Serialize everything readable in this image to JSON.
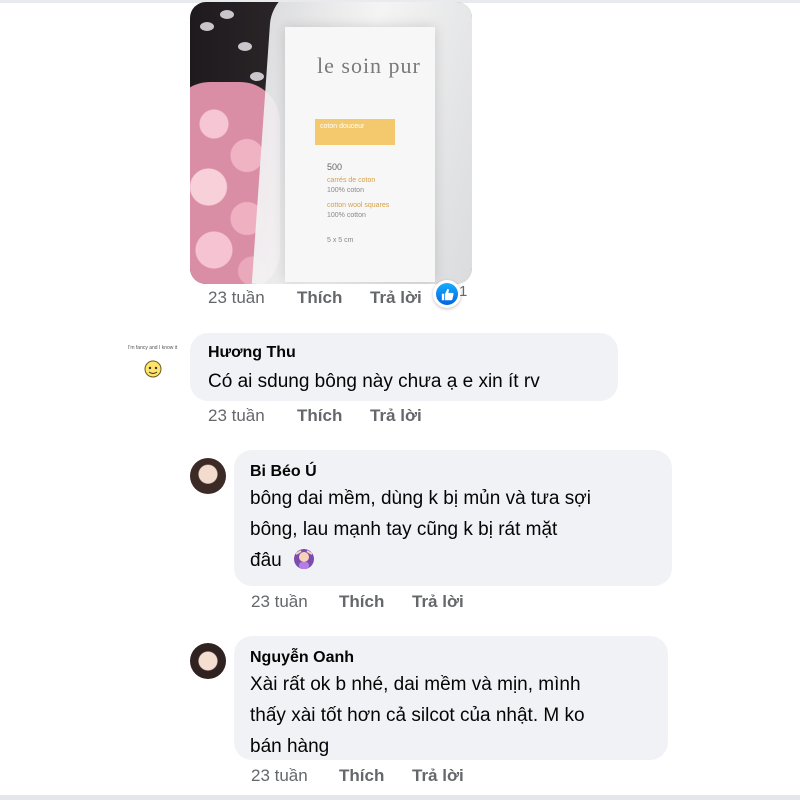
{
  "post_photo": {
    "brand_text": "le soin pur",
    "band_text": "coton douceur",
    "count_text": "500",
    "line1": "carrés de coton",
    "line2": "100% coton",
    "line3": "cotton wool squares",
    "line4": "100% cotton",
    "size_text": "5 x 5 cm"
  },
  "photo_meta": {
    "time": "23 tuần",
    "like_label": "Thích",
    "reply_label": "Trả lời",
    "reaction_count": "1"
  },
  "comments": [
    {
      "author": "Hương Thu",
      "avatar_caption": "I'm fancy and I know it",
      "text": "Có ai sdung bông này chưa ạ e xin ít rv",
      "time": "23 tuần",
      "like_label": "Thích",
      "reply_label": "Trả lời"
    },
    {
      "author": "Bi Béo Ú",
      "text_lines": [
        "bông dai mềm, dùng k bị mủn và tưa sợi",
        "bông, lau mạnh tay cũng k bị rát mặt",
        "đâu"
      ],
      "time": "23 tuần",
      "like_label": "Thích",
      "reply_label": "Trả lời"
    },
    {
      "author": "Nguyễn Oanh",
      "text_lines": [
        "Xài rất ok b nhé, dai mềm và mịn, mình",
        "thấy xài tốt hơn cả silcot của nhật. M ko",
        "bán hàng"
      ],
      "time": "23 tuần",
      "like_label": "Thích",
      "reply_label": "Trả lời"
    }
  ],
  "colors": {
    "bubble": "#f0f2f5",
    "meta_text": "#65676b",
    "like_blue": "#0165e1"
  },
  "icons": {
    "reaction": "thumbs-up-icon",
    "emoji": "woman-gesturing-emoji-icon",
    "avatar_sticker": "smiley-sticker-icon"
  }
}
